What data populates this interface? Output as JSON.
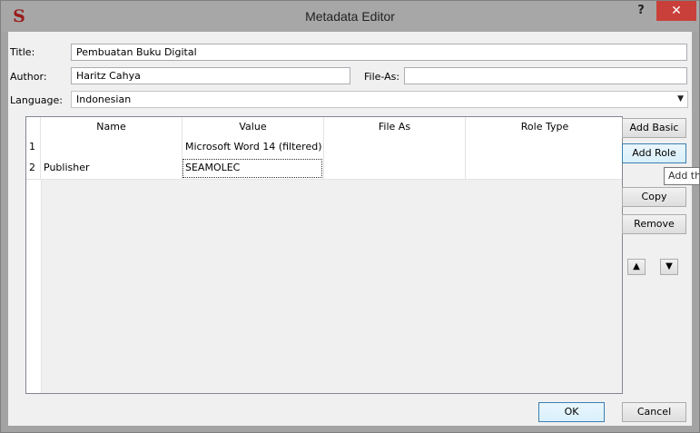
{
  "window": {
    "title": "Metadata Editor",
    "app_icon_glyph": "S",
    "help_label": "?",
    "close_label": "✕",
    "accent_close": "#c9403a"
  },
  "form": {
    "title_label": "Title:",
    "title_value": "Pembuatan Buku Digital",
    "author_label": "Author:",
    "author_value": "Haritz Cahya",
    "file_as_label": "File-As:",
    "file_as_value": "",
    "language_label": "Language:",
    "language_value": "Indonesian"
  },
  "table": {
    "columns": [
      "Name",
      "Value",
      "File As",
      "Role Type"
    ],
    "rows": [
      {
        "num": "1",
        "name": "",
        "value": "Microsoft Word 14 (filtered)",
        "file_as": "",
        "role_type": ""
      },
      {
        "num": "2",
        "name": "Publisher",
        "value": "SEAMOLEC",
        "file_as": "",
        "role_type": ""
      }
    ]
  },
  "side_buttons": {
    "add_basic": "Add Basic",
    "add_role": "Add Role",
    "tooltip": "Add th",
    "copy": "Copy",
    "remove": "Remove",
    "move_up_icon": "triangle-up-icon",
    "move_down_icon": "triangle-down-icon"
  },
  "footer": {
    "ok": "OK",
    "cancel": "Cancel"
  }
}
